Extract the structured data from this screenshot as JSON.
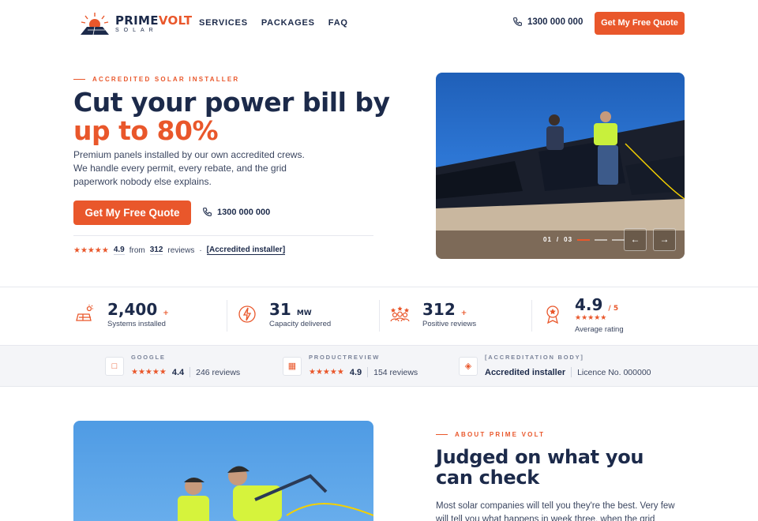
{
  "brand": {
    "name_part1": "PRIME",
    "name_part2": "VOLT",
    "sub": "SOLAR"
  },
  "nav": [
    "SERVICES",
    "PACKAGES",
    "FAQ"
  ],
  "header": {
    "phone": "1300 000 000",
    "cta": "Get My Free Quote"
  },
  "hero": {
    "eyebrow": "ACCREDITED SOLAR INSTALLER",
    "title_line1": "Cut your power bill by",
    "title_line2": "up to 80%",
    "description": "Premium panels installed by our own accredited crews. We handle every permit, every rebate, and the grid paperwork nobody else explains.",
    "cta": "Get My Free Quote",
    "phone": "1300 000 000",
    "rating_stars": "★★★★★",
    "rating": "4.9",
    "from": "from",
    "review_count": "312",
    "reviews_word": "reviews",
    "dot": "·",
    "badge": "[Accredited installer]"
  },
  "slider": {
    "current": "01",
    "sep": "/",
    "total": "03",
    "prev": "←",
    "next": "→"
  },
  "stats": [
    {
      "value": "2,400",
      "unit": "+",
      "label": "Systems installed",
      "icon": "solar-panel-icon"
    },
    {
      "value": "31",
      "unit": "MW",
      "label": "Capacity delivered",
      "icon": "lightning-icon"
    },
    {
      "value": "312",
      "unit": "+",
      "label": "Positive reviews",
      "icon": "people-stars-icon"
    },
    {
      "value": "4.9",
      "unit": "/ 5",
      "label": "Average rating",
      "stars": "★★★★★",
      "icon": "award-icon"
    }
  ],
  "reviews": [
    {
      "source": "GOOGLE",
      "stars": "★★★★★",
      "score": "4.4",
      "count": "246 reviews",
      "icon": "chat-icon"
    },
    {
      "source": "PRODUCTREVIEW",
      "stars": "★★★★★",
      "score": "4.9",
      "count": "154 reviews",
      "icon": "clipboard-icon"
    },
    {
      "source": "[ACCREDITATION BODY]",
      "title": "Accredited installer",
      "licence": "Licence No. 000000",
      "icon": "shield-icon"
    }
  ],
  "about": {
    "eyebrow": "ABOUT PRIME VOLT",
    "title": "Judged on what you can check",
    "text": "Most solar companies will tell you they're the best. Very few will tell you what happens in week three, when the grid application"
  },
  "colors": {
    "accent": "#e9572b",
    "navy": "#1c2a4a",
    "band": "#f4f5f8"
  }
}
